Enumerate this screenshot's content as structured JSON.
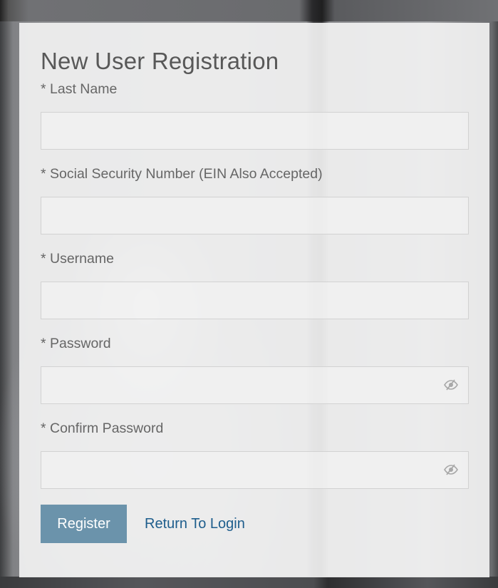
{
  "form": {
    "title": "New User Registration",
    "fields": [
      {
        "label": "* Last Name",
        "value": "",
        "placeholder": ""
      },
      {
        "label": "* Social Security Number (EIN Also Accepted)",
        "value": "",
        "placeholder": ""
      },
      {
        "label": "* Username",
        "value": "",
        "placeholder": ""
      },
      {
        "label": "* Password",
        "value": "",
        "placeholder": "",
        "icon": "eye-slash-icon"
      },
      {
        "label": "* Confirm Password",
        "value": "",
        "placeholder": "",
        "icon": "eye-slash-icon"
      }
    ],
    "register_label": "Register",
    "return_label": "Return To Login"
  },
  "colors": {
    "button_bg": "#6b93ab",
    "link": "#1d5d8c",
    "card_bg": "#f1f1f1",
    "label_text": "#666666"
  }
}
